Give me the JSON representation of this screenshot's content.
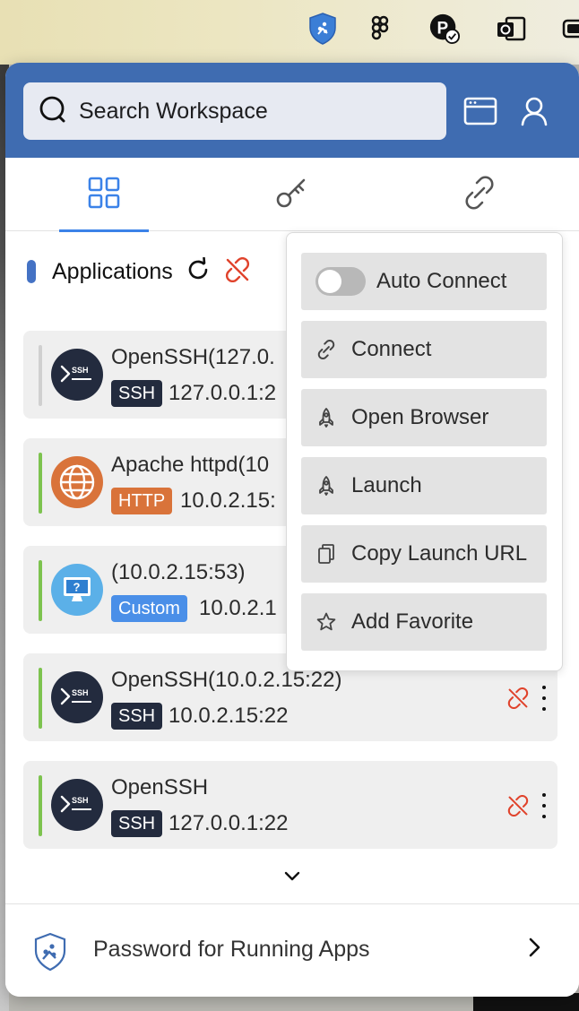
{
  "menubar": {
    "icons": [
      "splashtop-shield-icon",
      "figma-icon",
      "p-badge-icon",
      "outlook-icon",
      "battery-icon"
    ]
  },
  "search": {
    "placeholder": "Search Workspace",
    "icons": [
      "search-icon"
    ]
  },
  "header": {
    "buttons": [
      "browser-window-icon",
      "user-icon"
    ]
  },
  "tabs": [
    {
      "icon": "apps-grid-icon",
      "active": true
    },
    {
      "icon": "key-icon",
      "active": false
    },
    {
      "icon": "link-icon",
      "active": false
    }
  ],
  "section": {
    "title": "Applications",
    "icons": [
      "refresh-icon",
      "unlink-icon"
    ]
  },
  "apps": [
    {
      "name": "OpenSSH(127.0.",
      "tag": "SSH",
      "address": "127.0.0.1:2",
      "status_color": "#d0d0d0",
      "logo": "ssh-icon"
    },
    {
      "name": "Apache httpd(10",
      "tag": "HTTP",
      "address": "10.0.2.15:",
      "status_color": "#7dc34f",
      "logo": "globe-icon"
    },
    {
      "name": "(10.0.2.15:53)",
      "tag": "Custom",
      "address": "10.0.2.1",
      "status_color": "#7dc34f",
      "logo": "monitor-help-icon"
    },
    {
      "name": "OpenSSH(10.0.2.15:22)",
      "tag": "SSH",
      "address": "10.0.2.15:22",
      "status_color": "#7dc34f",
      "logo": "ssh-icon"
    },
    {
      "name": "OpenSSH",
      "tag": "SSH",
      "address": "127.0.0.1:22",
      "status_color": "#7dc34f",
      "logo": "ssh-icon"
    }
  ],
  "tag_colors": {
    "SSH": "#232b3e",
    "HTTP": "#d9733a",
    "Custom": "#4a8fe8"
  },
  "menu": {
    "items": [
      {
        "label": "Auto Connect",
        "icon": "toggle-switch"
      },
      {
        "label": "Connect",
        "icon": "link-icon"
      },
      {
        "label": "Open Browser",
        "icon": "rocket-icon"
      },
      {
        "label": "Launch",
        "icon": "rocket-icon"
      },
      {
        "label": "Copy Launch URL",
        "icon": "copy-icon"
      },
      {
        "label": "Add Favorite",
        "icon": "star-icon"
      }
    ]
  },
  "footer": {
    "text": "Password for Running Apps"
  },
  "colors": {
    "header_bg": "#3f6cb1",
    "accent": "#3b82e8",
    "unlink_red": "#e0432c"
  }
}
